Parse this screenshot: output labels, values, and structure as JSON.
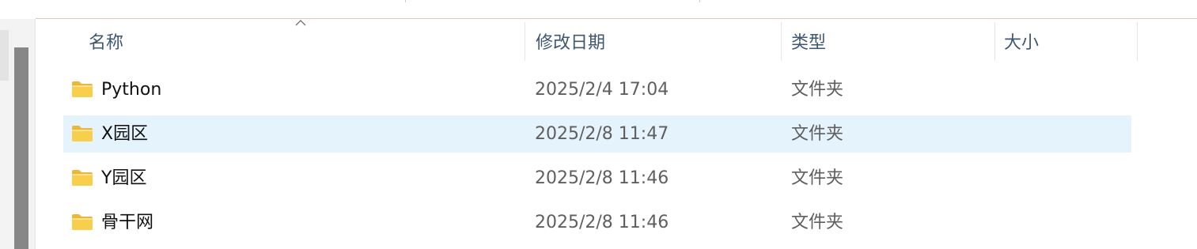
{
  "columns": {
    "name": "名称",
    "date": "修改日期",
    "type": "类型",
    "size": "大小"
  },
  "sort": {
    "column": "name",
    "direction": "ascending"
  },
  "colors": {
    "selected_row": "#e5f3fd",
    "header_text": "#3f5771",
    "folder_yellow": "#f8cf4c",
    "scrollbar_thumb": "#878787"
  },
  "rows": [
    {
      "icon": "folder-icon",
      "name": "Python",
      "date": "2025/2/4 17:04",
      "type": "文件夹",
      "size": "",
      "selected": false
    },
    {
      "icon": "folder-icon",
      "name": "X园区",
      "date": "2025/2/8 11:47",
      "type": "文件夹",
      "size": "",
      "selected": true
    },
    {
      "icon": "folder-icon",
      "name": "Y园区",
      "date": "2025/2/8 11:46",
      "type": "文件夹",
      "size": "",
      "selected": false
    },
    {
      "icon": "folder-icon",
      "name": "骨干网",
      "date": "2025/2/8 11:46",
      "type": "文件夹",
      "size": "",
      "selected": false
    }
  ]
}
